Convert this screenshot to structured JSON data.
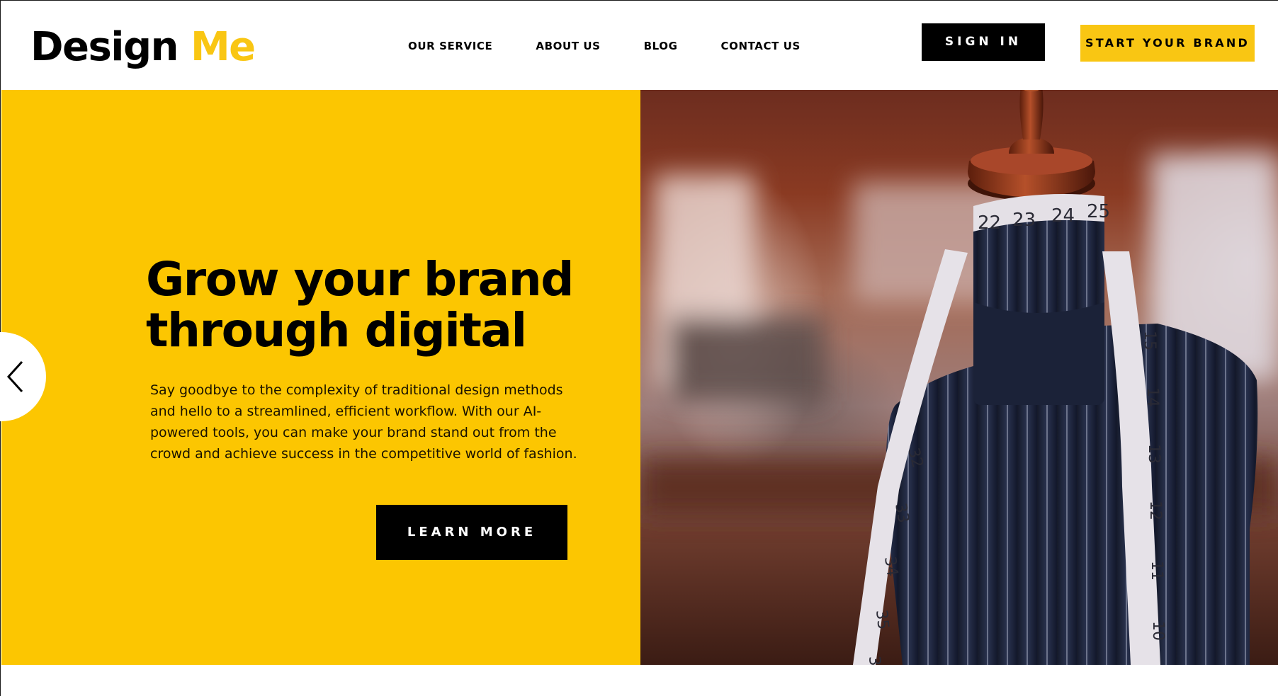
{
  "brand": {
    "name_main": "Design",
    "name_accent": "Me",
    "accent_color": "#f9c613"
  },
  "nav": {
    "items": [
      {
        "label": "OUR SERVICE"
      },
      {
        "label": "ABOUT US"
      },
      {
        "label": "BLOG"
      },
      {
        "label": "CONTACT US"
      }
    ]
  },
  "header_actions": {
    "sign_in": "SIGN IN",
    "start_brand": "START YOUR BRAND"
  },
  "hero": {
    "title_line1": "Grow your brand",
    "title_line2": "through digital",
    "body": "Say goodbye to the complexity of traditional design methods and hello to a streamlined, efficient workflow. With our AI-powered tools, you can make your brand stand out from the crowd and achieve success in the competitive world of fashion.",
    "cta": "LEARN MORE",
    "background_color": "#fcc601"
  },
  "carousel": {
    "prev_icon": "chevron-left-icon"
  },
  "hero_image": {
    "subject": "tailor-mannequin-with-measuring-tape",
    "tape_numbers": [
      "22",
      "23",
      "24",
      "25",
      "15",
      "14",
      "13",
      "12",
      "11",
      "10",
      "32",
      "33",
      "34",
      "35",
      "36"
    ]
  }
}
